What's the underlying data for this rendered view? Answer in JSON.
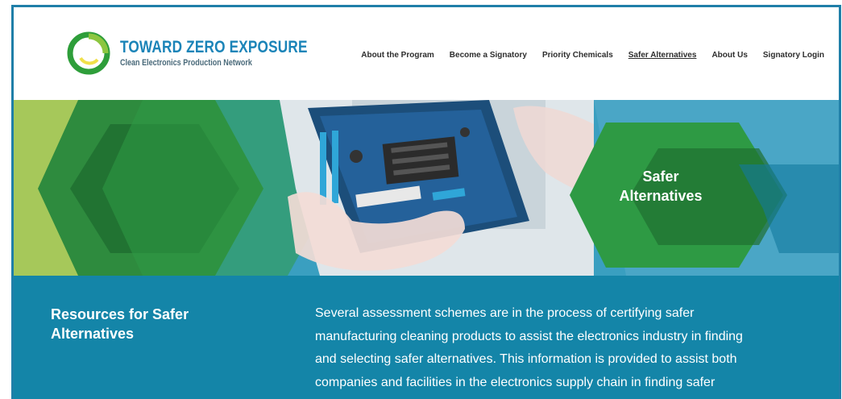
{
  "header": {
    "logo_title": "TOWARD ZERO EXPOSURE",
    "logo_subtitle": "Clean Electronics Production Network",
    "nav": [
      {
        "label": "About the Program"
      },
      {
        "label": "Become a Signatory"
      },
      {
        "label": "Priority Chemicals"
      },
      {
        "label": "Safer Alternatives",
        "active": true
      },
      {
        "label": "About Us"
      },
      {
        "label": "Signatory Login"
      }
    ]
  },
  "hero": {
    "title_line1": "Safer",
    "title_line2": "Alternatives"
  },
  "content": {
    "side_title": "Resources for Safer Alternatives",
    "body_lines": [
      "Several assessment schemes are in the process of certifying safer",
      "manufacturing cleaning products to assist the electronics industry in finding",
      "and selecting safer alternatives. This information is provided to assist both",
      "companies and facilities in the electronics supply chain in finding safer"
    ]
  },
  "colors": {
    "brand_blue": "#1b84b8",
    "content_bg": "#1485a8",
    "hex_green": "#1f8a3a",
    "light_green": "#8cc63f"
  }
}
